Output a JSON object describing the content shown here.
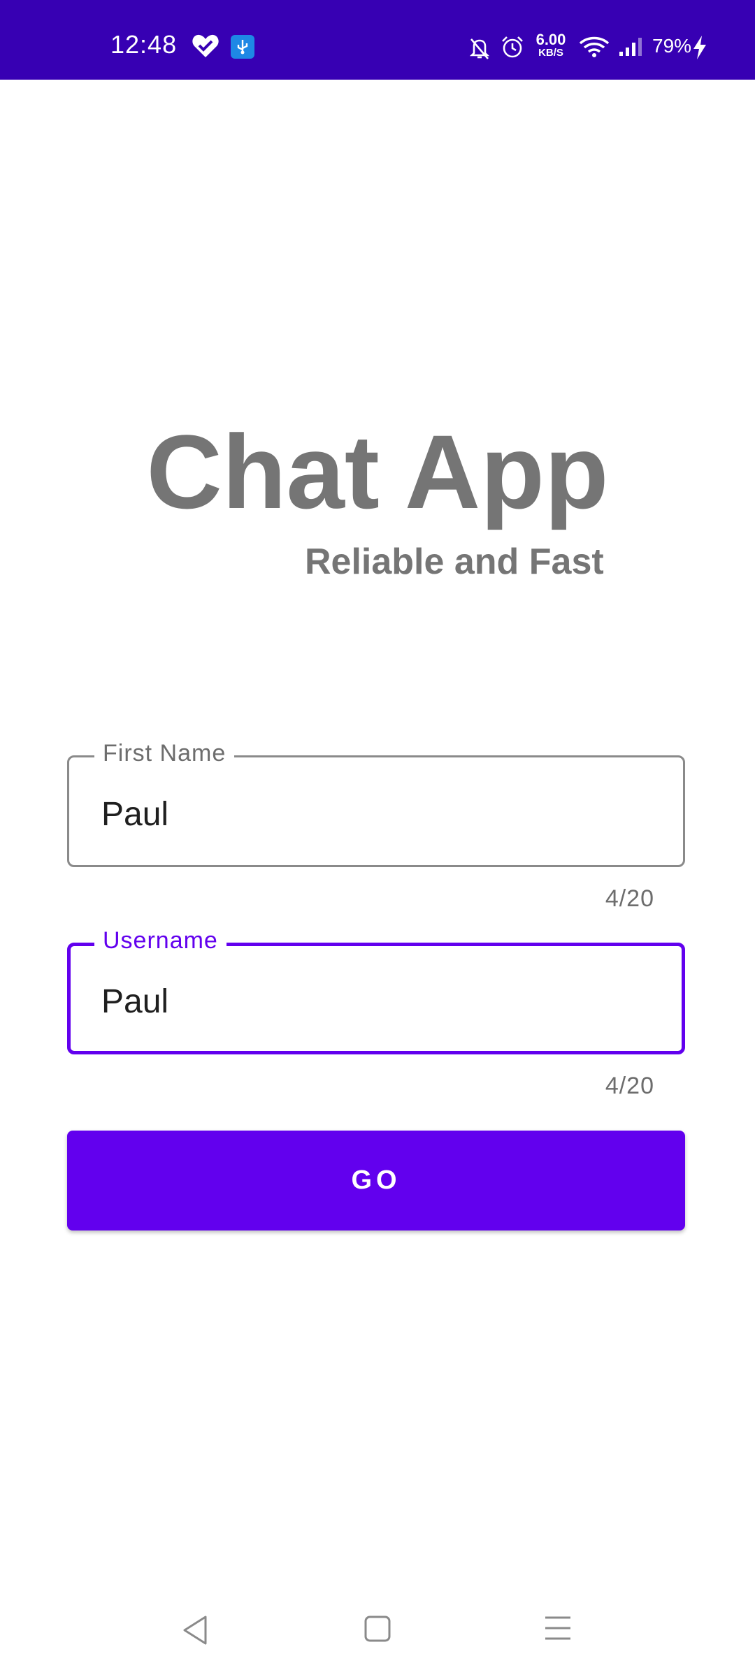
{
  "status_bar": {
    "time": "12:48",
    "speed_value": "6.00",
    "speed_unit": "KB/S",
    "battery": "79%",
    "background_color": "#3700b3",
    "icons": [
      "heart-icon",
      "usb-icon",
      "bell-off-icon",
      "alarm-icon",
      "wifi-icon",
      "signal-icon",
      "charging-icon"
    ]
  },
  "app": {
    "title": "Chat App",
    "subtitle": "Reliable and Fast"
  },
  "form": {
    "first_name": {
      "label": "First Name",
      "value": "Paul",
      "counter": "4/20"
    },
    "username": {
      "label": "Username",
      "value": "Paul",
      "counter": "4/20",
      "focused": true
    },
    "submit_label": "GO",
    "accent_color": "#6200ee"
  },
  "nav_bar": {
    "icons": [
      "back-icon",
      "home-icon",
      "menu-icon"
    ]
  }
}
